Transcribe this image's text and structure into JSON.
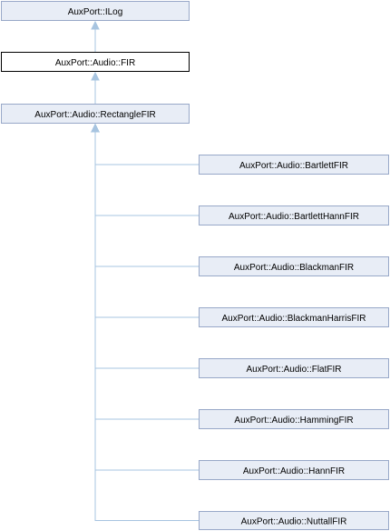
{
  "diagram": {
    "type": "class-inheritance-graph",
    "colors": {
      "node_fill": "#e8edf6",
      "node_stroke": "#98a8c8",
      "current_fill": "#ffffff",
      "current_stroke": "#000000",
      "edge": "#a7c4e0"
    },
    "nodes": [
      {
        "id": "ilog",
        "label": "AuxPort::ILog",
        "current": false
      },
      {
        "id": "fir",
        "label": "AuxPort::Audio::FIR",
        "current": true
      },
      {
        "id": "rect",
        "label": "AuxPort::Audio::RectangleFIR",
        "current": false
      },
      {
        "id": "bartlett",
        "label": "AuxPort::Audio::BartlettFIR",
        "current": false
      },
      {
        "id": "bartletthann",
        "label": "AuxPort::Audio::BartlettHannFIR",
        "current": false
      },
      {
        "id": "blackman",
        "label": "AuxPort::Audio::BlackmanFIR",
        "current": false
      },
      {
        "id": "blackmanharris",
        "label": "AuxPort::Audio::BlackmanHarrisFIR",
        "current": false
      },
      {
        "id": "flat",
        "label": "AuxPort::Audio::FlatFIR",
        "current": false
      },
      {
        "id": "hamming",
        "label": "AuxPort::Audio::HammingFIR",
        "current": false
      },
      {
        "id": "hann",
        "label": "AuxPort::Audio::HannFIR",
        "current": false
      },
      {
        "id": "nuttall",
        "label": "AuxPort::Audio::NuttallFIR",
        "current": false
      }
    ],
    "edges": [
      {
        "from": "fir",
        "to": "ilog"
      },
      {
        "from": "rect",
        "to": "fir"
      },
      {
        "from": "bartlett",
        "to": "rect"
      },
      {
        "from": "bartletthann",
        "to": "rect"
      },
      {
        "from": "blackman",
        "to": "rect"
      },
      {
        "from": "blackmanharris",
        "to": "rect"
      },
      {
        "from": "flat",
        "to": "rect"
      },
      {
        "from": "hamming",
        "to": "rect"
      },
      {
        "from": "hann",
        "to": "rect"
      },
      {
        "from": "nuttall",
        "to": "rect"
      }
    ]
  }
}
